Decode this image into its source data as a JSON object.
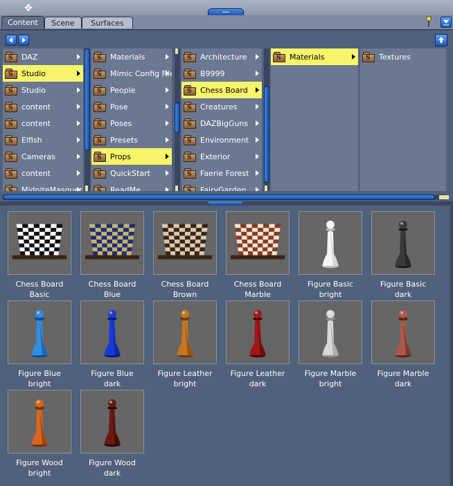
{
  "tabs": [
    {
      "label": "Content",
      "active": true
    },
    {
      "label": "Scene",
      "active": false
    },
    {
      "label": "Surfaces",
      "active": false
    }
  ],
  "columns": [
    {
      "items": [
        {
          "label": "DAZ",
          "selected": false
        },
        {
          "label": "Studio",
          "selected": true
        },
        {
          "label": "Studio",
          "selected": false
        },
        {
          "label": "content",
          "selected": false
        },
        {
          "label": "content",
          "selected": false
        },
        {
          "label": "Elfish",
          "selected": false
        },
        {
          "label": "Cameras",
          "selected": false
        },
        {
          "label": "content",
          "selected": false
        },
        {
          "label": "MidniteMasquerade",
          "selected": false
        }
      ]
    },
    {
      "items": [
        {
          "label": "Materials",
          "selected": false
        },
        {
          "label": "Mimic Config Files",
          "selected": false
        },
        {
          "label": "People",
          "selected": false
        },
        {
          "label": "Pose",
          "selected": false
        },
        {
          "label": "Poses",
          "selected": false
        },
        {
          "label": "Presets",
          "selected": false
        },
        {
          "label": "Props",
          "selected": true
        },
        {
          "label": "QuickStart",
          "selected": false
        },
        {
          "label": "ReadMe",
          "selected": false
        }
      ]
    },
    {
      "items": [
        {
          "label": "Architecture",
          "selected": false
        },
        {
          "label": "B9999",
          "selected": false
        },
        {
          "label": "Chess Board",
          "selected": true
        },
        {
          "label": "Creatures",
          "selected": false
        },
        {
          "label": "DAZBigGuns",
          "selected": false
        },
        {
          "label": "Environment",
          "selected": false
        },
        {
          "label": "Exterior",
          "selected": false
        },
        {
          "label": "Faerie Forest",
          "selected": false
        },
        {
          "label": "FairyGarden",
          "selected": false
        }
      ]
    },
    {
      "items": [
        {
          "label": "Materials",
          "selected": true
        }
      ]
    },
    {
      "items": [
        {
          "label": "Textures",
          "selected": false
        }
      ]
    }
  ],
  "grid": {
    "items": [
      {
        "line1": "Chess Board",
        "line2": "Basic",
        "kind": "board",
        "light": "#ffffff",
        "dark": "#111111"
      },
      {
        "line1": "Chess Board",
        "line2": "Blue",
        "kind": "board",
        "light": "#c7b46a",
        "dark": "#1c2d7a"
      },
      {
        "line1": "Chess Board",
        "line2": "Brown",
        "kind": "board",
        "light": "#d9c9b0",
        "dark": "#3a2418"
      },
      {
        "line1": "Chess Board",
        "line2": "Marble",
        "kind": "board",
        "light": "#efe6d6",
        "dark": "#8a3a20"
      },
      {
        "line1": "Figure Basic",
        "line2": "bright",
        "kind": "pawn",
        "color": "#f4f4f4",
        "shade": "#b9b9b9"
      },
      {
        "line1": "Figure Basic",
        "line2": "dark",
        "kind": "pawn",
        "color": "#3a3a3a",
        "shade": "#1a1a1a"
      },
      {
        "line1": "Figure Blue",
        "line2": "bright",
        "kind": "pawn",
        "color": "#2f8fe0",
        "shade": "#0b4a9a"
      },
      {
        "line1": "Figure Blue",
        "line2": "dark",
        "kind": "pawn",
        "color": "#1a3ad8",
        "shade": "#081a7a"
      },
      {
        "line1": "Figure Leather",
        "line2": "bright",
        "kind": "pawn",
        "color": "#c8771e",
        "shade": "#6a3a08"
      },
      {
        "line1": "Figure Leather",
        "line2": "dark",
        "kind": "pawn",
        "color": "#a01818",
        "shade": "#4a0606"
      },
      {
        "line1": "Figure Marble",
        "line2": "bright",
        "kind": "pawn",
        "color": "#d8d8d8",
        "shade": "#8a8a8a"
      },
      {
        "line1": "Figure Marble",
        "line2": "dark",
        "kind": "pawn",
        "color": "#a85a4a",
        "shade": "#5a2218"
      },
      {
        "line1": "Figure Wood",
        "line2": "bright",
        "kind": "pawn",
        "color": "#d8661e",
        "shade": "#7a2e06"
      },
      {
        "line1": "Figure Wood",
        "line2": "dark",
        "kind": "pawn",
        "color": "#6a1a10",
        "shade": "#2a0604"
      }
    ]
  },
  "icons": {
    "back": "left-arrow-icon",
    "forward": "right-arrow-icon",
    "up": "up-folder-icon",
    "pin": "pin-icon",
    "menu": "panel-menu-icon"
  }
}
